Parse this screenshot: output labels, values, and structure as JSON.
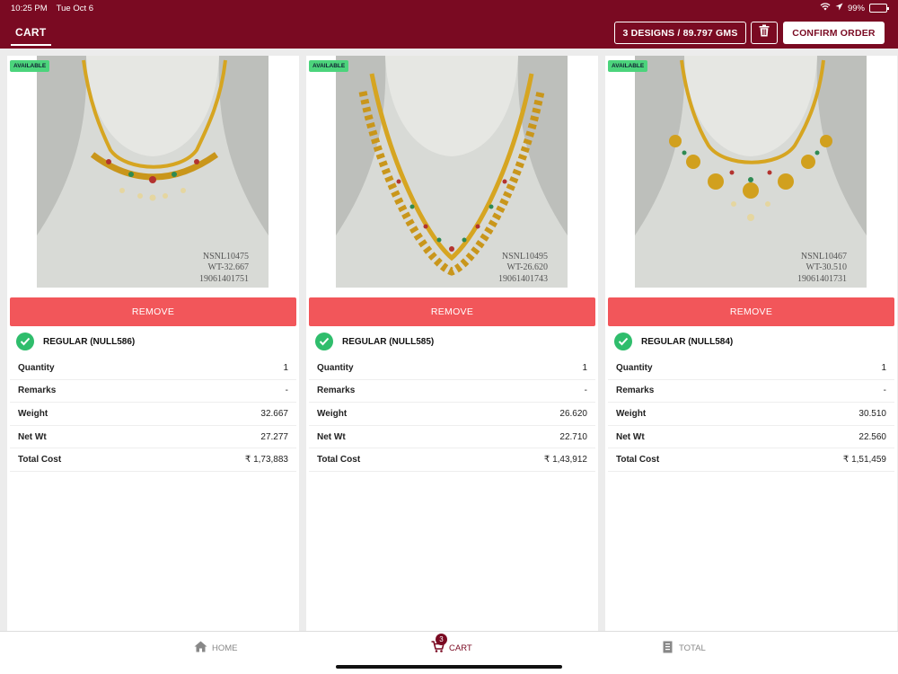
{
  "status": {
    "time": "10:25 PM",
    "date": "Tue Oct 6",
    "battery": "99%"
  },
  "nav": {
    "tab": "CART",
    "summary": "3 DESIGNS / 89.797 GMS",
    "confirm": "CONFIRM ORDER"
  },
  "labels": {
    "available": "AVAILABLE",
    "remove": "REMOVE",
    "quantity": "Quantity",
    "remarks": "Remarks",
    "weight": "Weight",
    "net_wt": "Net Wt",
    "total_cost": "Total Cost"
  },
  "items": [
    {
      "caption": [
        "NSNL10475",
        "WT-32.667",
        "19061401751"
      ],
      "variant": "REGULAR (NULL586)",
      "quantity": "1",
      "remarks": "-",
      "weight": "32.667",
      "net_wt": "27.277",
      "total_cost": "₹ 1,73,883"
    },
    {
      "caption": [
        "NSNL10495",
        "WT-26.620",
        "19061401743"
      ],
      "variant": "REGULAR (NULL585)",
      "quantity": "1",
      "remarks": "-",
      "weight": "26.620",
      "net_wt": "22.710",
      "total_cost": "₹ 1,43,912"
    },
    {
      "caption": [
        "NSNL10467",
        "WT-30.510",
        "19061401731"
      ],
      "variant": "REGULAR (NULL584)",
      "quantity": "1",
      "remarks": "-",
      "weight": "30.510",
      "net_wt": "22.560",
      "total_cost": "₹ 1,51,459"
    }
  ],
  "tabbar": {
    "home": "HOME",
    "cart": "CART",
    "cart_count": "3",
    "total": "TOTAL"
  },
  "colors": {
    "brand": "#7a0a22",
    "remove": "#f2565a",
    "available": "#4cd47c",
    "check": "#2fbd6c"
  }
}
